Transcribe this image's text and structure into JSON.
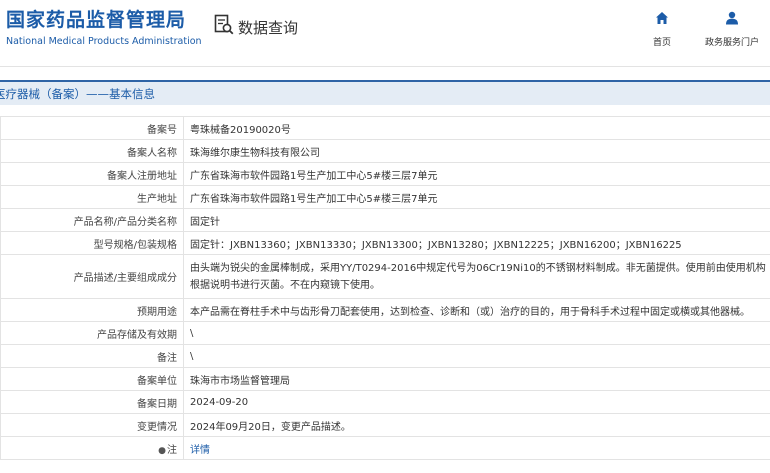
{
  "header": {
    "logo_cn": "国家药品监督管理局",
    "logo_en": "National Medical Products Administration",
    "query_label": "数据查询",
    "nav": [
      {
        "label": "首页",
        "icon": "home-icon"
      },
      {
        "label": "政务服务门户",
        "icon": "user-icon"
      }
    ]
  },
  "page_title": "医疗器械（备案）——基本信息",
  "rows": [
    {
      "label": "备案号",
      "value": "粤珠械备20190020号"
    },
    {
      "label": "备案人名称",
      "value": "珠海维尔康生物科技有限公司"
    },
    {
      "label": "备案人注册地址",
      "value": "广东省珠海市软件园路1号生产加工中心5#楼三层7单元"
    },
    {
      "label": "生产地址",
      "value": "广东省珠海市软件园路1号生产加工中心5#楼三层7单元"
    },
    {
      "label": "产品名称/产品分类名称",
      "value": "固定针"
    },
    {
      "label": "型号规格/包装规格",
      "value": "固定针：JXBN13360；JXBN13330；JXBN13300；JXBN13280；JXBN12225；JXBN16200；JXBN16225"
    },
    {
      "label": "产品描述/主要组成成分",
      "value": "由头端为锐尖的金属棒制成，采用YY/T0294-2016中规定代号为06Cr19Ni10的不锈钢材料制成。非无菌提供。使用前由使用机构根据说明书进行灭菌。不在内窥镜下使用。"
    },
    {
      "label": "预期用途",
      "value": "本产品需在脊柱手术中与齿形骨刀配套使用，达到检查、诊断和（或）治疗的目的，用于骨科手术过程中固定或横或其他器械。"
    },
    {
      "label": "产品存储及有效期",
      "value": "\\"
    },
    {
      "label": "备注",
      "value": "\\"
    },
    {
      "label": "备案单位",
      "value": "珠海市市场监督管理局"
    },
    {
      "label": "备案日期",
      "value": "2024-09-20"
    },
    {
      "label": "变更情况",
      "value": "2024年09月20日，变更产品描述。"
    },
    {
      "label": "注",
      "value": "详情"
    }
  ],
  "colors": {
    "brand": "#1c5ca8",
    "title_bar_bg": "#e4ecf5",
    "border": "#e3e3e3"
  }
}
